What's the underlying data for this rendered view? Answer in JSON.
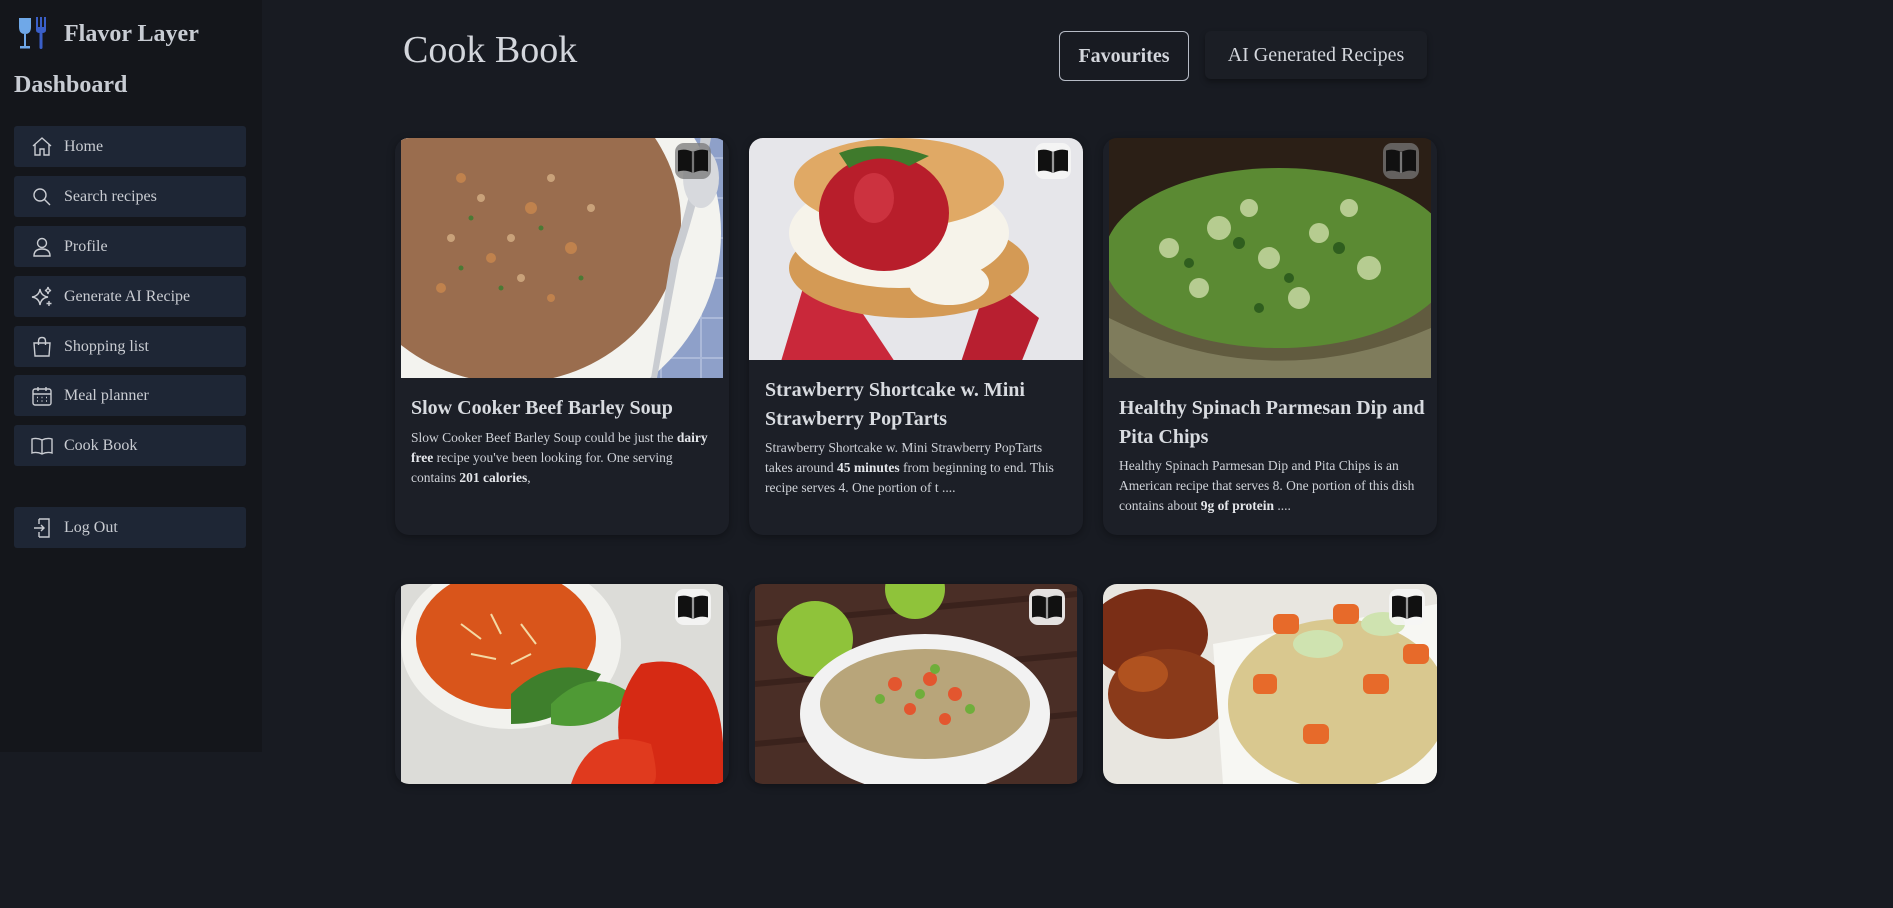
{
  "app": {
    "name": "Flavor Layer"
  },
  "sidebar": {
    "title": "Dashboard",
    "items": [
      {
        "label": "Home",
        "icon": "home-icon"
      },
      {
        "label": "Search recipes",
        "icon": "search-icon"
      },
      {
        "label": "Profile",
        "icon": "user-icon"
      },
      {
        "label": "Generate AI Recipe",
        "icon": "sparkles-icon"
      },
      {
        "label": "Shopping list",
        "icon": "shopping-bag-icon"
      },
      {
        "label": "Meal planner",
        "icon": "calendar-icon"
      },
      {
        "label": "Cook Book",
        "icon": "book-icon"
      }
    ],
    "logout": {
      "label": "Log Out",
      "icon": "logout-icon"
    }
  },
  "page": {
    "title": "Cook Book",
    "tabs": [
      {
        "label": "Favourites",
        "active": true
      },
      {
        "label": "AI Generated Recipes",
        "active": false
      }
    ]
  },
  "recipes": [
    {
      "title": "Slow Cooker Beef Barley Soup",
      "desc": [
        {
          "t": "Slow Cooker Beef Barley Soup could be just the "
        },
        {
          "t": "dairy free",
          "b": true
        },
        {
          "t": " recipe you've been looking for. One serving contains "
        },
        {
          "t": "201 calories",
          "b": true
        },
        {
          "t": ","
        }
      ]
    },
    {
      "title": "Strawberry Shortcake w. Mini Strawberry PopTarts",
      "desc": [
        {
          "t": "Strawberry Shortcake w. Mini Strawberry PopTarts takes around "
        },
        {
          "t": "45 minutes",
          "b": true
        },
        {
          "t": " from beginning to end. This recipe serves 4. One portion of t ...."
        }
      ]
    },
    {
      "title": "Healthy Spinach Parmesan Dip and Pita Chips",
      "desc": [
        {
          "t": "Healthy Spinach Parmesan Dip and Pita Chips is an American recipe that serves 8. One portion of this dish contains about "
        },
        {
          "t": "9g of protein",
          "b": true
        },
        {
          "t": " ...."
        }
      ]
    },
    {
      "title": "",
      "desc": []
    },
    {
      "title": "",
      "desc": []
    },
    {
      "title": "",
      "desc": []
    }
  ],
  "colors": {
    "background": "#181b22",
    "sidebar": "#14161b",
    "nav_item": "#1e2635",
    "card": "#1c1f27",
    "logo_glass": "#6fa8e8",
    "logo_fork": "#3a5fc8"
  }
}
